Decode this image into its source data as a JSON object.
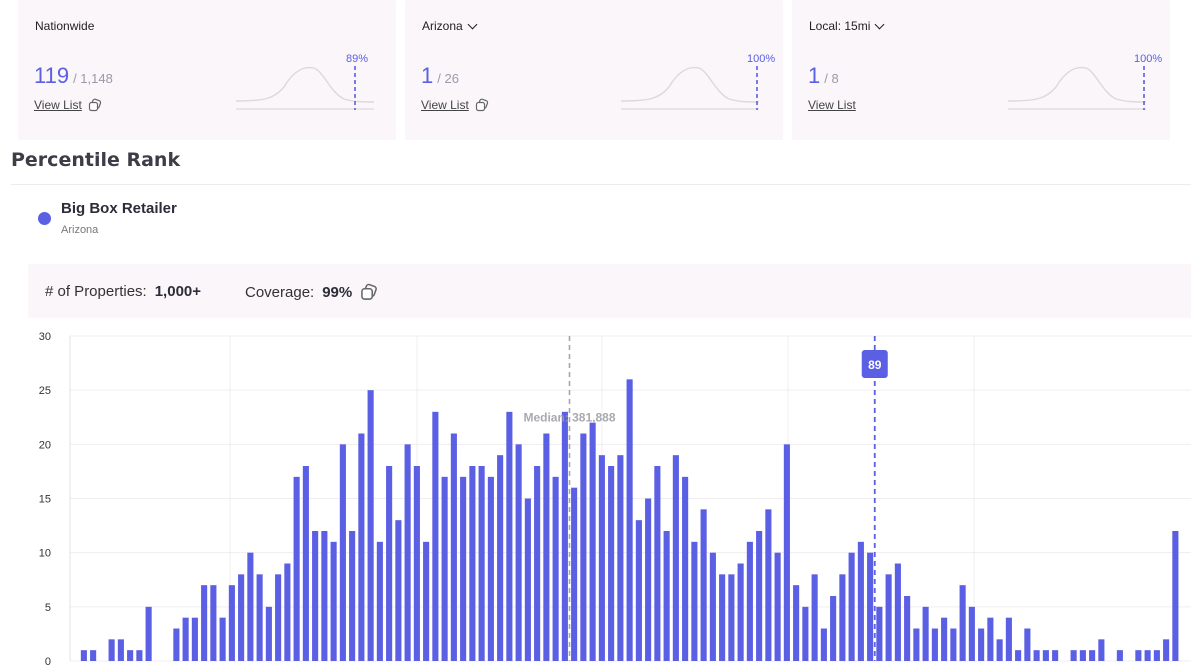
{
  "cards": [
    {
      "title": "Nationwide",
      "has_dropdown": false,
      "rank": "119",
      "total": "/ 1,148",
      "percentile": "89%",
      "percentile_value": 89,
      "view_list": "View List"
    },
    {
      "title": "Arizona",
      "has_dropdown": true,
      "rank": "1",
      "total": "/ 26",
      "percentile": "100%",
      "percentile_value": 100,
      "view_list": "View List"
    },
    {
      "title": "Local: 15mi",
      "has_dropdown": true,
      "rank": "1",
      "total": "/ 8",
      "percentile": "100%",
      "percentile_value": 100,
      "view_list": "View List"
    }
  ],
  "section_title": "Percentile Rank",
  "legend": {
    "name": "Big Box Retailer",
    "subtitle": "Arizona",
    "color": "#5b5fe4"
  },
  "stats": {
    "properties_label": "# of Properties:",
    "properties_value": "1,000+",
    "coverage_label": "Coverage:",
    "coverage_value": "99%"
  },
  "colors": {
    "accent": "#5b5fe4",
    "card_bg": "#faf6fa"
  },
  "chart_data": {
    "type": "bar",
    "title": "",
    "xlabel": "",
    "ylabel": "",
    "ylim": [
      0,
      30
    ],
    "yticks": [
      0,
      5,
      10,
      15,
      20,
      25,
      30
    ],
    "grid": true,
    "values": [
      0,
      1,
      1,
      0,
      2,
      2,
      1,
      1,
      5,
      0,
      0,
      3,
      4,
      4,
      7,
      7,
      4,
      7,
      8,
      10,
      8,
      5,
      8,
      9,
      17,
      18,
      12,
      12,
      11,
      20,
      12,
      21,
      25,
      11,
      18,
      13,
      20,
      18,
      11,
      23,
      17,
      21,
      17,
      18,
      18,
      17,
      19,
      23,
      20,
      15,
      18,
      21,
      17,
      23,
      16,
      21,
      22,
      19,
      18,
      19,
      26,
      13,
      15,
      18,
      12,
      19,
      17,
      11,
      14,
      10,
      8,
      8,
      9,
      11,
      12,
      14,
      10,
      20,
      7,
      5,
      8,
      3,
      6,
      8,
      10,
      11,
      10,
      5,
      8,
      9,
      6,
      3,
      5,
      3,
      4,
      3,
      7,
      5,
      3,
      4,
      2,
      4,
      1,
      3,
      1,
      1,
      1,
      0,
      1,
      1,
      1,
      2,
      0,
      1,
      0,
      1,
      1,
      1,
      2,
      12
    ],
    "median_label": "Median: 381,888",
    "median_index": 53.5,
    "marker_label": "89",
    "marker_index": 86.5
  }
}
